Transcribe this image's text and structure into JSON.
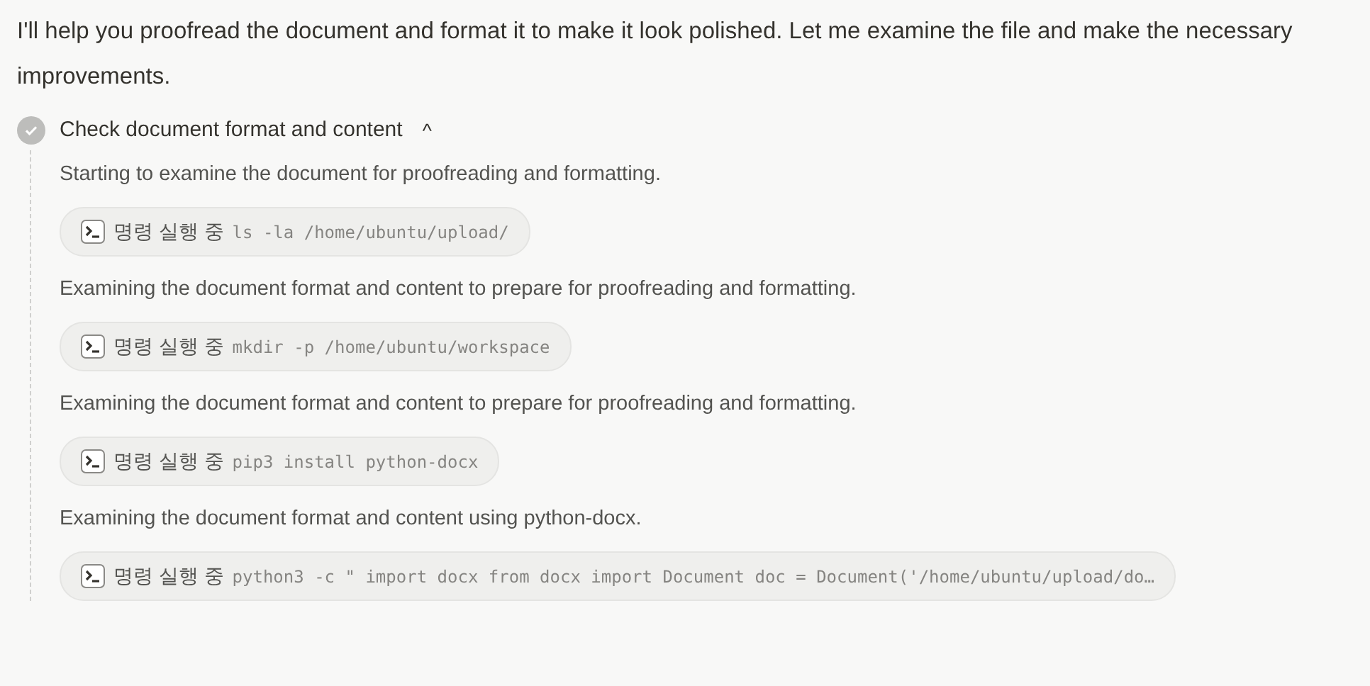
{
  "message": "I'll help you proofread the document and format it to make it look polished. Let me examine the file and make the necessary improvements.",
  "step": {
    "title": "Check document format and content",
    "done": true,
    "expanded": true,
    "caret": "^",
    "items": [
      {
        "kind": "text",
        "text": "Starting to examine the document for proofreading and formatting."
      },
      {
        "kind": "command",
        "label": "명령 실행 중",
        "command": "ls -la /home/ubuntu/upload/"
      },
      {
        "kind": "text",
        "text": "Examining the document format and content to prepare for proofreading and formatting."
      },
      {
        "kind": "command",
        "label": "명령 실행 중",
        "command": "mkdir -p /home/ubuntu/workspace"
      },
      {
        "kind": "text",
        "text": "Examining the document format and content to prepare for proofreading and formatting."
      },
      {
        "kind": "command",
        "label": "명령 실행 중",
        "command": "pip3 install python-docx"
      },
      {
        "kind": "text",
        "text": "Examining the document format and content using python-docx."
      },
      {
        "kind": "command",
        "label": "명령 실행 중",
        "command": "python3 -c \" import docx from docx import Document doc = Document('/home/ubuntu/upload/do…"
      }
    ]
  }
}
